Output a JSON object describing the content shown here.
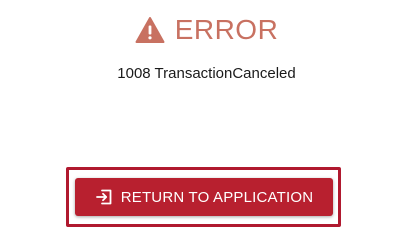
{
  "error": {
    "title": "ERROR",
    "icon": "warning-triangle-icon",
    "message": "1008 TransactionCanceled"
  },
  "actions": {
    "return_label": "RETURN TO APPLICATION",
    "return_icon": "sign-in-arrow-icon"
  },
  "colors": {
    "error_title": "#c87161",
    "button_background": "#b8202f",
    "focus_ring": "#b0192f",
    "button_text": "#ffffff"
  }
}
